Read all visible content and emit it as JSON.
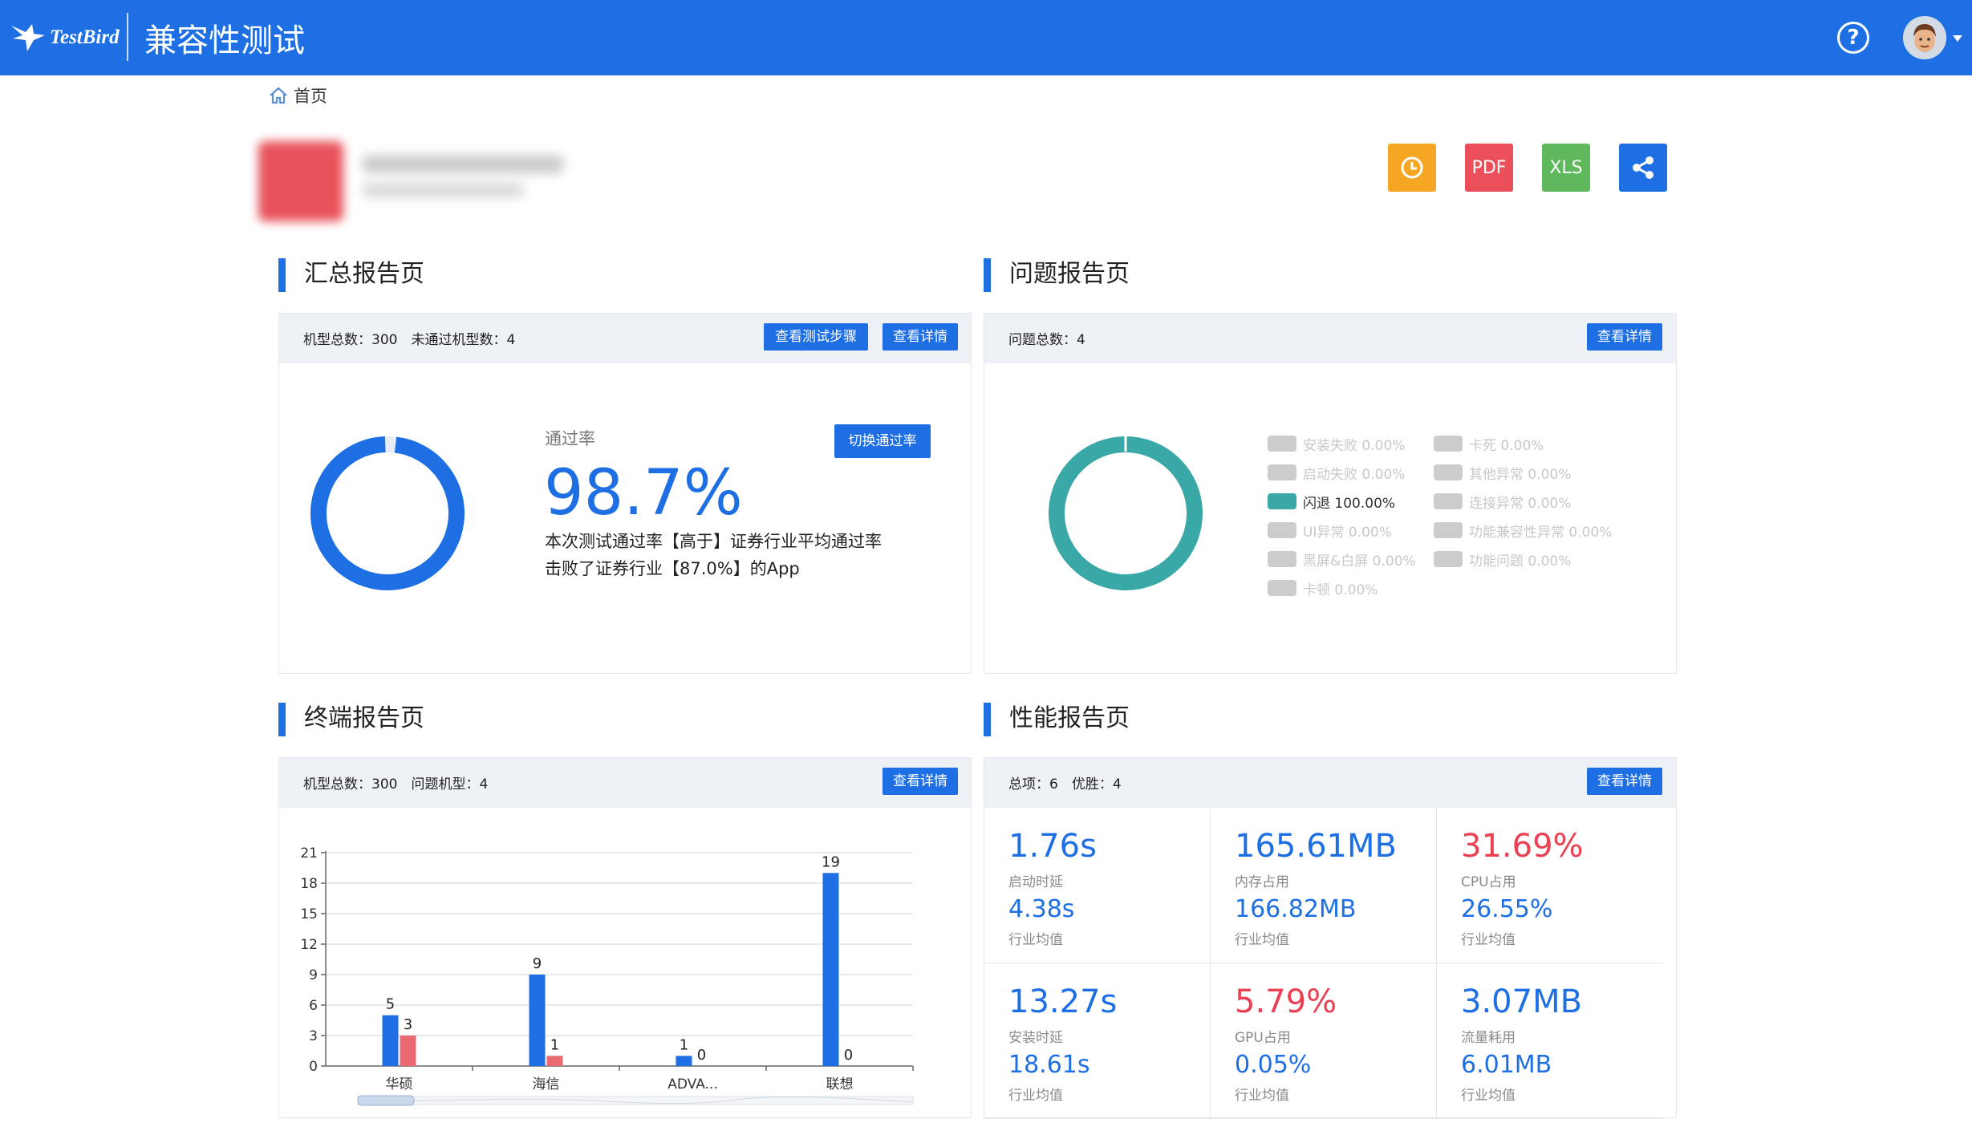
{
  "header": {
    "logo_text": "TestBird",
    "title": "兼容性测试",
    "help_icon": "help-icon",
    "colors": {
      "brand": "#1d6fe3"
    }
  },
  "breadcrumb": {
    "home_label": "首页"
  },
  "actions": {
    "pdf_label": "PDF",
    "xls_label": "XLS"
  },
  "summary": {
    "title": "汇总报告页",
    "stats": "机型总数：300　未通过机型数：4",
    "btn_steps": "查看测试步骤",
    "btn_details": "查看详情",
    "btn_switch": "切换通过率",
    "pass_label": "通过率",
    "pass_value": "98.7%",
    "pass_rate": 0.987,
    "line1": "本次测试通过率【高于】证券行业平均通过率",
    "line2": "击败了证券行业【87.0%】的App"
  },
  "issues": {
    "title": "问题报告页",
    "stats": "问题总数：4",
    "btn_details": "查看详情",
    "legend": [
      {
        "label": "安装失败  0.00%",
        "active": false
      },
      {
        "label": "启动失败  0.00%",
        "active": false
      },
      {
        "label": "闪退  100.00%",
        "active": true
      },
      {
        "label": "UI异常  0.00%",
        "active": false
      },
      {
        "label": "黑屏&白屏  0.00%",
        "active": false
      },
      {
        "label": "卡顿  0.00%",
        "active": false
      },
      {
        "label": "卡死  0.00%",
        "active": false
      },
      {
        "label": "其他异常  0.00%",
        "active": false
      },
      {
        "label": "连接异常  0.00%",
        "active": false
      },
      {
        "label": "功能兼容性异常  0.00%",
        "active": false
      },
      {
        "label": "功能问题  0.00%",
        "active": false
      }
    ]
  },
  "terminal": {
    "title": "终端报告页",
    "stats": "机型总数：300　问题机型：4",
    "btn_details": "查看详情"
  },
  "chart_data": {
    "type": "bar",
    "categories": [
      "华硕",
      "海信",
      "ADVA...",
      "联想"
    ],
    "series": [
      {
        "values": [
          5,
          9,
          1,
          19
        ],
        "color": "#1d6fe3"
      },
      {
        "values": [
          3,
          1,
          0,
          0
        ],
        "color": "#ea6a72"
      }
    ],
    "yticks": [
      0,
      3,
      6,
      9,
      12,
      15,
      18,
      21
    ],
    "ylim": [
      0,
      21
    ],
    "grid": true
  },
  "performance": {
    "title": "性能报告页",
    "stats": "总项：6　优胜：4",
    "btn_details": "查看详情",
    "items": [
      {
        "value": "1.76s",
        "label": "启动时延",
        "avg": "4.38s",
        "avg_label": "行业均值",
        "color": "blue"
      },
      {
        "value": "165.61MB",
        "label": "内存占用",
        "avg": "166.82MB",
        "avg_label": "行业均值",
        "color": "blue"
      },
      {
        "value": "31.69%",
        "label": "CPU占用",
        "avg": "26.55%",
        "avg_label": "行业均值",
        "color": "red"
      },
      {
        "value": "13.27s",
        "label": "安装时延",
        "avg": "18.61s",
        "avg_label": "行业均值",
        "color": "blue"
      },
      {
        "value": "5.79%",
        "label": "GPU占用",
        "avg": "0.05%",
        "avg_label": "行业均值",
        "color": "red"
      },
      {
        "value": "3.07MB",
        "label": "流量耗用",
        "avg": "6.01MB",
        "avg_label": "行业均值",
        "color": "blue"
      }
    ]
  }
}
